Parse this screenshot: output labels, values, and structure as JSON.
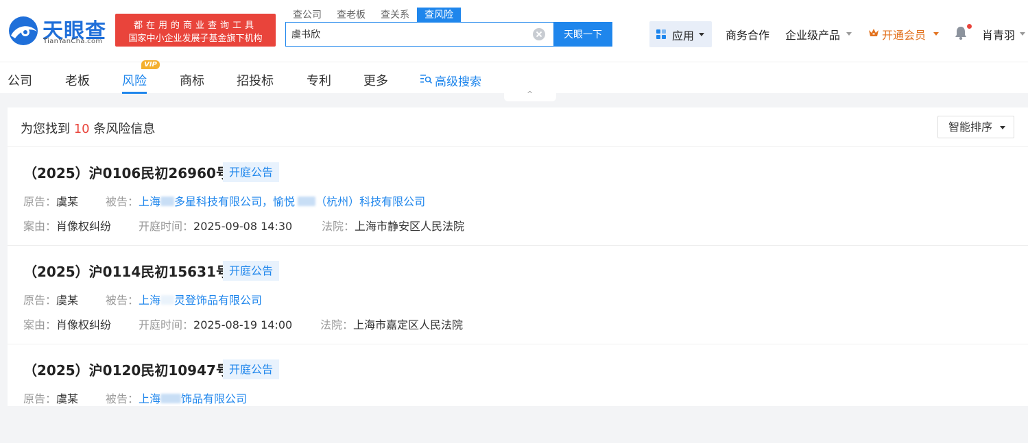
{
  "header": {
    "logo": {
      "name": "天眼查",
      "en": "TianYanCha.com"
    },
    "slogan": {
      "line1": "都在用的商业查询工具",
      "line2": "国家中小企业发展子基金旗下机构"
    },
    "search_tabs": [
      "查公司",
      "查老板",
      "查关系",
      "查风险"
    ],
    "search_value": "虞书欣",
    "search_button": "天眼一下",
    "nav": {
      "app": "应用",
      "business": "商务合作",
      "enterprise": "企业级产品",
      "vip": "开通会员",
      "user": "肖青羽"
    }
  },
  "categories": {
    "items": [
      "公司",
      "老板",
      "风险",
      "商标",
      "招投标",
      "专利",
      "更多",
      "高级搜索"
    ],
    "vip_badge": "VIP",
    "collapse": "^"
  },
  "results": {
    "prefix": "为您找到",
    "count": "10",
    "suffix": "条风险信息",
    "sort": "智能排序",
    "labels": {
      "plaintiff": "原告：",
      "defendant": "被告：",
      "cause": "案由：",
      "hearing_time": "开庭时间：",
      "court": "法院："
    },
    "items": [
      {
        "case_no": "（2025）沪0106民初26960号",
        "tag": "开庭公告",
        "plaintiff": "虞某",
        "defendant_a1": "上海",
        "defendant_a2": "多星科技有限公司，",
        "defendant_b1": "愉悦",
        "defendant_b2": "（杭州）科技有限公司",
        "cause": "肖像权纠纷",
        "hearing_time": "2025-09-08 14:30",
        "court": "上海市静安区人民法院"
      },
      {
        "case_no": "（2025）沪0114民初15631号",
        "tag": "开庭公告",
        "plaintiff": "虞某",
        "defendant_a1": "上海",
        "defendant_a2": "灵登饰品有限公司",
        "cause": "肖像权纠纷",
        "hearing_time": "2025-08-19 14:00",
        "court": "上海市嘉定区人民法院"
      },
      {
        "case_no": "（2025）沪0120民初10947号",
        "tag": "开庭公告",
        "plaintiff": "虞某",
        "defendant_a1": "上海",
        "defendant_a2": "饰品有限公司"
      }
    ]
  },
  "colors": {
    "brand_blue": "#1f86ec",
    "logo_blue": "#1f6fd9",
    "slogan_red": "#e9443b",
    "vip_orange": "#e2711d"
  }
}
